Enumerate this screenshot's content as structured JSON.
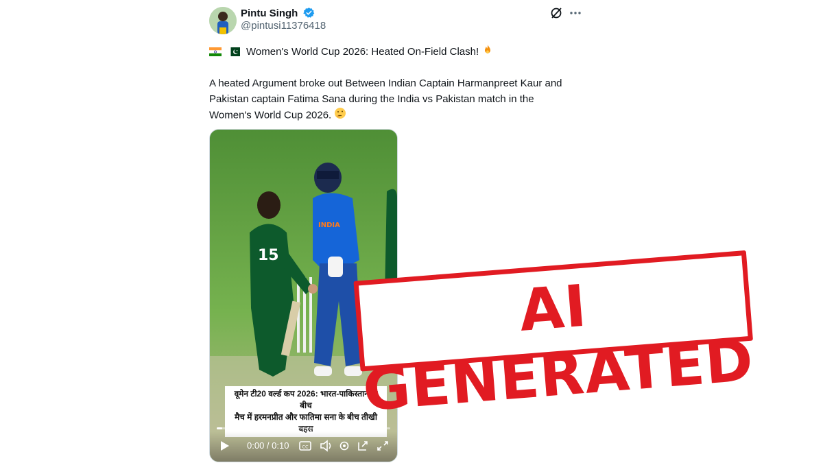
{
  "author": {
    "name": "Pintu Singh",
    "handle": "@pintusi11376418",
    "verified": true
  },
  "post": {
    "title": "Women's World Cup 2026: Heated On-Field Clash!",
    "body": "A heated Argument broke out Between Indian Captain Harmanpreet Kaur and Pakistan captain Fatima Sana during the India vs Pakistan match in the Women's World Cup 2026."
  },
  "video": {
    "caption_line1": "वूमेन टी20 वर्ल्ड कप 2026: भारत-पाकिस्तान के बीच",
    "caption_line2": "मैच में हरमनप्रीत और फातिमा सना के बीच तीखी बहस",
    "time_display": "0:00 / 0:10",
    "progress": 0.03,
    "jersey_india": "INDIA",
    "jersey_pak_number": "15"
  },
  "overlay": {
    "stamp_text": "AI GENERATED"
  },
  "icons": [
    "verified-badge-icon",
    "grok-icon",
    "more-icon",
    "india-flag-icon",
    "pakistan-flag-icon",
    "fire-emoji-icon",
    "thinking-emoji-icon",
    "play-icon",
    "captions-icon",
    "volume-icon",
    "settings-icon",
    "pip-icon",
    "fullscreen-icon"
  ],
  "colors": {
    "stamp_red": "#e11b22",
    "verified_blue": "#1d9bf0",
    "handle_gray": "#536471"
  }
}
